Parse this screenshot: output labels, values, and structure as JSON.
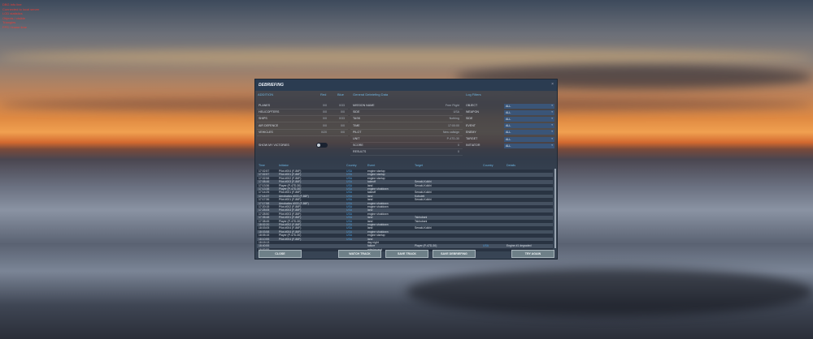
{
  "debug_lines": [
    "DBG info line",
    "Connected to local server",
    "LOD statistics",
    "Objects / visible",
    "Triangles",
    "FPS / frame time"
  ],
  "window": {
    "title": "DEBRIEFING",
    "close": "×"
  },
  "stats": {
    "header": "ADDITION",
    "col_red": "Red",
    "col_blue": "Blue",
    "rows": [
      {
        "label": "PLANES",
        "red": "0/0",
        "blue": "0/33"
      },
      {
        "label": "HELICOPTERS",
        "red": "0/0",
        "blue": "0/0"
      },
      {
        "label": "SHIPS",
        "red": "0/0",
        "blue": "0/33"
      },
      {
        "label": "AIR DEFENCE",
        "red": "0/0",
        "blue": "0/0"
      },
      {
        "label": "VEHICLES",
        "red": "0/20",
        "blue": "0/0"
      }
    ],
    "show_victories": "SHOW MY VICTORIES",
    "show_victories_on": false
  },
  "general": {
    "header": "General Debriefing Data",
    "rows": [
      {
        "label": "MISSION NAME",
        "value": "Free Flight"
      },
      {
        "label": "SIDE",
        "value": "USA"
      },
      {
        "label": "TASK",
        "value": "Nothing"
      },
      {
        "label": "TIME",
        "value": "17:00:00"
      },
      {
        "label": "PILOT",
        "value": "New callsign"
      },
      {
        "label": "UNIT",
        "value": "P-47D-30"
      },
      {
        "label": "SCORE",
        "value": "0"
      },
      {
        "label": "RESULTS",
        "value": "0"
      }
    ]
  },
  "filters": {
    "header": "Log Filters",
    "items": [
      {
        "label": "OBJECT",
        "value": "ALL"
      },
      {
        "label": "WEAPON",
        "value": "ALL"
      },
      {
        "label": "SIDE",
        "value": "ALL"
      },
      {
        "label": "EVENT",
        "value": "ALL"
      },
      {
        "label": "ENEMY",
        "value": "ALL"
      },
      {
        "label": "TARGET",
        "value": "ALL"
      },
      {
        "label": "INITIATOR",
        "value": "ALL"
      }
    ]
  },
  "log": {
    "columns": [
      "Time",
      "Initiator",
      "Country",
      "Event",
      "Target",
      "Country",
      "Details"
    ],
    "rows": [
      [
        "17:02:57",
        "Pilot #004 (F-86F)",
        "USA",
        "engine startup",
        "",
        "",
        ""
      ],
      [
        "17:02:57",
        "Pilot #001 (F-86F)",
        "USA",
        "engine startup",
        "",
        "",
        ""
      ],
      [
        "17:02:58",
        "Pilot #002 (F-86F)",
        "USA",
        "engine startup",
        "",
        "",
        ""
      ],
      [
        "17:08:46",
        "Pilot #003 (F-86F)",
        "USA",
        "takeoff",
        "Senaki-Kolkhi",
        "",
        ""
      ],
      [
        "17:13:36",
        "Player (P-47D-30)",
        "USA",
        "land",
        "Senaki-Kolkhi",
        "",
        ""
      ],
      [
        "17:13:38",
        "Player (P-47D-30)",
        "USA",
        "engine shutdown",
        "",
        "",
        ""
      ],
      [
        "17:14:25",
        "Pilot #001 (F-86F)",
        "USA",
        "takeoff",
        "Senaki-Kolkhi",
        "",
        ""
      ],
      [
        "17:14:37",
        "Aerobatics #003 (F-86F)",
        "USA",
        "land",
        "Kobuleti",
        "",
        ""
      ],
      [
        "17:17:36",
        "Pilot #001 (F-86F)",
        "USA",
        "land",
        "Senaki-Kolkhi",
        "",
        ""
      ],
      [
        "17:17:58",
        "Aerobatics #003 (F-86F)",
        "USA",
        "engine shutdown",
        "",
        "",
        ""
      ],
      [
        "17:20:15",
        "Pilot #002 (F-86F)",
        "USA",
        "engine shutdown",
        "",
        "",
        ""
      ],
      [
        "17:25:05",
        "Pilot #003 (F-86F)",
        "USA",
        "land",
        "",
        "",
        ""
      ],
      [
        "17:28:50",
        "Pilot #003 (F-86F)",
        "USA",
        "engine shutdown",
        "",
        "",
        ""
      ],
      [
        "17:35:48",
        "Pilot #001 (F-86F)",
        "USA",
        "land",
        "Tskhubani",
        "",
        ""
      ],
      [
        "17:38:45",
        "Player (P-47D-30)",
        "USA",
        "land",
        "Tskhubani",
        "",
        ""
      ],
      [
        "18:02:20",
        "Pilot #002 (F-86F)",
        "USA",
        "engine shutdown",
        "",
        "",
        ""
      ],
      [
        "18:03:05",
        "Pilot #004 (F-86F)",
        "USA",
        "land",
        "Senaki-Kolkhi",
        "",
        ""
      ],
      [
        "18:03:58",
        "Pilot #004 (F-86F)",
        "USA",
        "engine shutdown",
        "",
        "",
        ""
      ],
      [
        "18:05:15",
        "Player (P-47D-30)",
        "USA",
        "engine startup",
        "",
        "",
        ""
      ],
      [
        "18:10:55",
        "Pilot #004 (F-86F)",
        "USA",
        "land",
        "",
        "",
        ""
      ],
      [
        "18:15:13",
        "",
        "",
        "day night",
        "",
        "",
        ""
      ],
      [
        "18:40:55",
        "",
        "",
        "failure",
        "Player (P-47D-30)",
        "USA",
        "Engine #1 degraded"
      ],
      [
        "18:53:55",
        "",
        "",
        "mission end",
        "",
        "",
        ""
      ]
    ]
  },
  "buttons": {
    "close": "CLOSE",
    "watch_track": "WATCH TRACK",
    "save_track": "SAVE TRACK",
    "save_debriefing": "SAVE DEBRIEFING",
    "try_again": "TRY AGAIN"
  }
}
